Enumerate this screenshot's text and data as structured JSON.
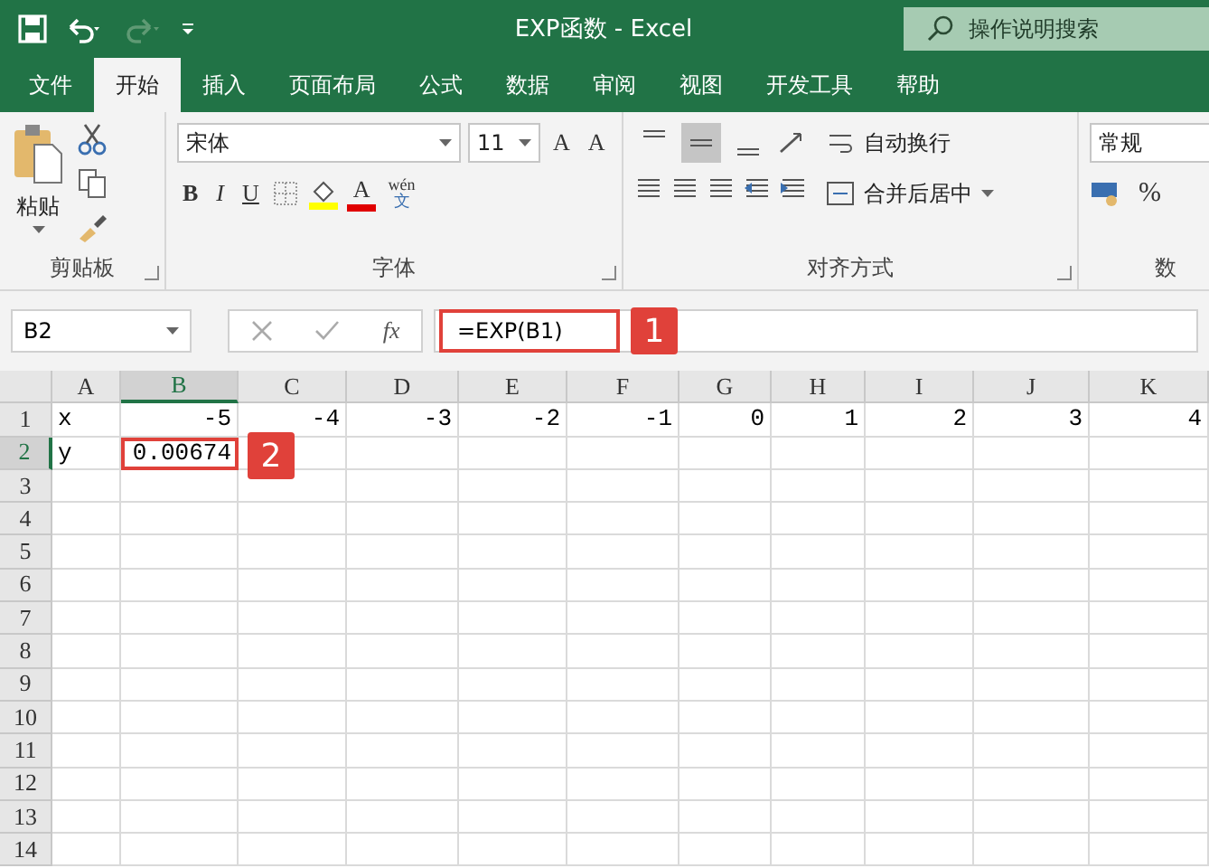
{
  "title_bar": {
    "title": "EXP函数  -  Excel",
    "search_placeholder": "操作说明搜索",
    "redo_disabled": true
  },
  "ribbon_tabs": [
    {
      "label": "文件",
      "selected": false
    },
    {
      "label": "开始",
      "selected": true
    },
    {
      "label": "插入",
      "selected": false
    },
    {
      "label": "页面布局",
      "selected": false
    },
    {
      "label": "公式",
      "selected": false
    },
    {
      "label": "数据",
      "selected": false
    },
    {
      "label": "审阅",
      "selected": false
    },
    {
      "label": "视图",
      "selected": false
    },
    {
      "label": "开发工具",
      "selected": false
    },
    {
      "label": "帮助",
      "selected": false
    }
  ],
  "clipboard": {
    "paste_label": "粘贴",
    "group_label": "剪贴板"
  },
  "font": {
    "font_name": "宋体",
    "font_size": "11",
    "grow": "A",
    "shrink": "A",
    "bold": "B",
    "italic": "I",
    "underline": "U",
    "font_color_letter": "A",
    "phonetic_top": "wén",
    "phonetic_bottom": "文",
    "group_label": "字体"
  },
  "alignment": {
    "vertical_buttons": [
      {
        "kind": "top",
        "selected": false
      },
      {
        "kind": "middle",
        "selected": true
      },
      {
        "kind": "bottom",
        "selected": false
      }
    ],
    "wrap_text": "自动换行",
    "merge_center": "合并后居中",
    "group_label": "对齐方式"
  },
  "number": {
    "format": "常规",
    "percent": "%",
    "group_label": "数"
  },
  "formula_bar": {
    "name_box": "B2",
    "function_label": "fx",
    "formula": "=EXP(B1)",
    "callout": "1"
  },
  "sheet": {
    "columns": [
      {
        "label": "A",
        "selected": false
      },
      {
        "label": "B",
        "selected": true
      },
      {
        "label": "C",
        "selected": false
      },
      {
        "label": "D",
        "selected": false
      },
      {
        "label": "E",
        "selected": false
      },
      {
        "label": "F",
        "selected": false
      },
      {
        "label": "G",
        "selected": false
      },
      {
        "label": "H",
        "selected": false
      },
      {
        "label": "I",
        "selected": false
      },
      {
        "label": "J",
        "selected": false
      },
      {
        "label": "K",
        "selected": false
      }
    ],
    "callout": "2",
    "rows": [
      {
        "label": "1",
        "selected": false,
        "cells": [
          {
            "text": "x",
            "kind": "text",
            "selected": false
          },
          {
            "text": "-5",
            "kind": "number",
            "selected": false
          },
          {
            "text": "-4",
            "kind": "number",
            "selected": false
          },
          {
            "text": "-3",
            "kind": "number",
            "selected": false
          },
          {
            "text": "-2",
            "kind": "number",
            "selected": false
          },
          {
            "text": "-1",
            "kind": "number",
            "selected": false
          },
          {
            "text": "0",
            "kind": "number",
            "selected": false
          },
          {
            "text": "1",
            "kind": "number",
            "selected": false
          },
          {
            "text": "2",
            "kind": "number",
            "selected": false
          },
          {
            "text": "3",
            "kind": "number",
            "selected": false
          },
          {
            "text": "4",
            "kind": "number",
            "selected": false
          }
        ]
      },
      {
        "label": "2",
        "selected": true,
        "cells": [
          {
            "text": "y",
            "kind": "text",
            "selected": false
          },
          {
            "text": "0.00674",
            "kind": "number",
            "selected": true
          }
        ]
      },
      {
        "label": "3",
        "selected": false
      },
      {
        "label": "4",
        "selected": false
      },
      {
        "label": "5",
        "selected": false
      },
      {
        "label": "6",
        "selected": false
      },
      {
        "label": "7",
        "selected": false
      },
      {
        "label": "8",
        "selected": false
      },
      {
        "label": "9",
        "selected": false
      },
      {
        "label": "10",
        "selected": false
      },
      {
        "label": "11",
        "selected": false
      },
      {
        "label": "12",
        "selected": false
      },
      {
        "label": "13",
        "selected": false
      },
      {
        "label": "14",
        "selected": false
      }
    ]
  }
}
